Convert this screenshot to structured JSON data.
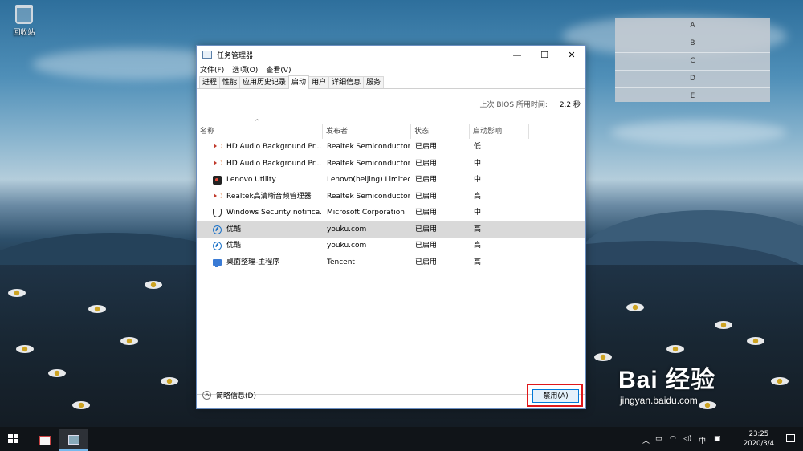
{
  "desktop": {
    "recycle_bin_label": "回收站",
    "overlay_list": [
      "A",
      "B",
      "C",
      "D",
      "E"
    ],
    "watermark_main": "Bai 经验",
    "watermark_sub": "jingyan.baidu.com"
  },
  "window": {
    "title": "任务管理器",
    "controls": {
      "minimize": "—",
      "maximize": "☐",
      "close": "✕"
    },
    "menu": [
      "文件(F)",
      "选项(O)",
      "查看(V)"
    ],
    "tabs": [
      "进程",
      "性能",
      "应用历史记录",
      "启动",
      "用户",
      "详细信息",
      "服务"
    ],
    "active_tab": "启动",
    "bios_label": "上次 BIOS 所用时间:",
    "bios_value": "2.2 秒",
    "columns": {
      "name": "名称",
      "publisher": "发布者",
      "status": "状态",
      "impact": "启动影响"
    },
    "rows": [
      {
        "icon": "speaker-icon",
        "name": "HD Audio Background Pr...",
        "publisher": "Realtek Semiconductor",
        "status": "已启用",
        "impact": "低"
      },
      {
        "icon": "speaker-icon",
        "name": "HD Audio Background Pr...",
        "publisher": "Realtek Semiconductor",
        "status": "已启用",
        "impact": "中"
      },
      {
        "icon": "lenovo-icon",
        "name": "Lenovo Utility",
        "publisher": "Lenovo(beijing) Limited",
        "status": "已启用",
        "impact": "中"
      },
      {
        "icon": "speaker-icon",
        "name": "Realtek高清晰音频管理器",
        "publisher": "Realtek Semiconductor",
        "status": "已启用",
        "impact": "高"
      },
      {
        "icon": "shield-icon",
        "name": "Windows Security notifica...",
        "publisher": "Microsoft Corporation",
        "status": "已启用",
        "impact": "中"
      },
      {
        "icon": "youku-icon",
        "name": "优酷",
        "publisher": "youku.com",
        "status": "已启用",
        "impact": "高"
      },
      {
        "icon": "youku-icon",
        "name": "优酷",
        "publisher": "youku.com",
        "status": "已启用",
        "impact": "高"
      },
      {
        "icon": "monitor-icon",
        "name": "桌面整理-主程序",
        "publisher": "Tencent",
        "status": "已启用",
        "impact": "高"
      }
    ],
    "selected_row_index": 5,
    "fewer_details_label": "简略信息(D)",
    "disable_button_label": "禁用(A)"
  },
  "taskbar": {
    "tray_ime": "中",
    "clock_time": "23:25",
    "clock_date": "2020/3/4"
  },
  "colors": {
    "accent": "#0078d7",
    "highlight_box": "#e0181b",
    "selected_row": "#d9d9d9"
  }
}
